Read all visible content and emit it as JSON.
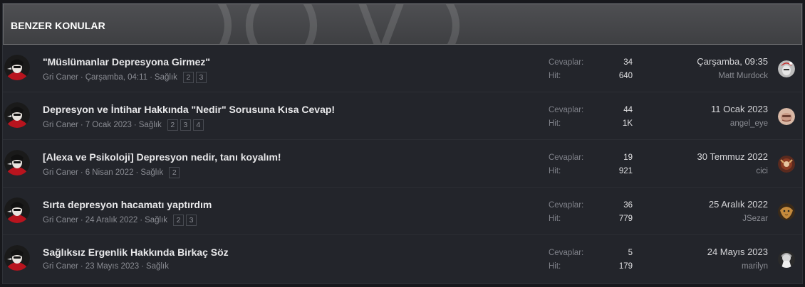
{
  "header": {
    "title": "BENZER KONULAR"
  },
  "threads": [
    {
      "title": "\"Müslümanlar Depresyona Girmez\"",
      "author": "Gri Caner",
      "date": "Çarşamba, 04:11",
      "forum": "Sağlık",
      "pages": [
        "2",
        "3"
      ],
      "replies_label": "Cevaplar:",
      "replies": "34",
      "views_label": "Hit:",
      "views": "640",
      "last_date": "Çarşamba, 09:35",
      "last_user": "Matt Murdock",
      "last_avatar": "matt-avatar"
    },
    {
      "title": "Depresyon ve İntihar Hakkında \"Nedir\" Sorusuna Kısa Cevap!",
      "author": "Gri Caner",
      "date": "7 Ocak 2023",
      "forum": "Sağlık",
      "pages": [
        "2",
        "3",
        "4"
      ],
      "replies_label": "Cevaplar:",
      "replies": "44",
      "views_label": "Hit:",
      "views": "1K",
      "last_date": "11 Ocak 2023",
      "last_user": "angel_eye",
      "last_avatar": "angel-avatar"
    },
    {
      "title": "[Alexa ve Psikoloji] Depresyon nedir, tanı koyalım!",
      "author": "Gri Caner",
      "date": "6 Nisan 2022",
      "forum": "Sağlık",
      "pages": [
        "2"
      ],
      "replies_label": "Cevaplar:",
      "replies": "19",
      "views_label": "Hit:",
      "views": "921",
      "last_date": "30 Temmuz 2022",
      "last_user": "cici",
      "last_avatar": "cici-avatar"
    },
    {
      "title": "Sırta depresyon hacamatı yaptırdım",
      "author": "Gri Caner",
      "date": "24 Aralık 2022",
      "forum": "Sağlık",
      "pages": [
        "2",
        "3"
      ],
      "replies_label": "Cevaplar:",
      "replies": "36",
      "views_label": "Hit:",
      "views": "779",
      "last_date": "25 Aralık 2022",
      "last_user": "JSezar",
      "last_avatar": "jsezar-avatar"
    },
    {
      "title": "Sağlıksız Ergenlik Hakkında Birkaç Söz",
      "author": "Gri Caner",
      "date": "23 Mayıs 2023",
      "forum": "Sağlık",
      "pages": [],
      "replies_label": "Cevaplar:",
      "replies": "5",
      "views_label": "Hit:",
      "views": "179",
      "last_date": "24 Mayıs 2023",
      "last_user": "marilyn",
      "last_avatar": "marilyn-avatar"
    }
  ],
  "colors": {
    "block_bg": "#23252b",
    "header_bg": "#47484b",
    "title_text": "#e8e8ea",
    "muted_text": "#8a8c93"
  }
}
